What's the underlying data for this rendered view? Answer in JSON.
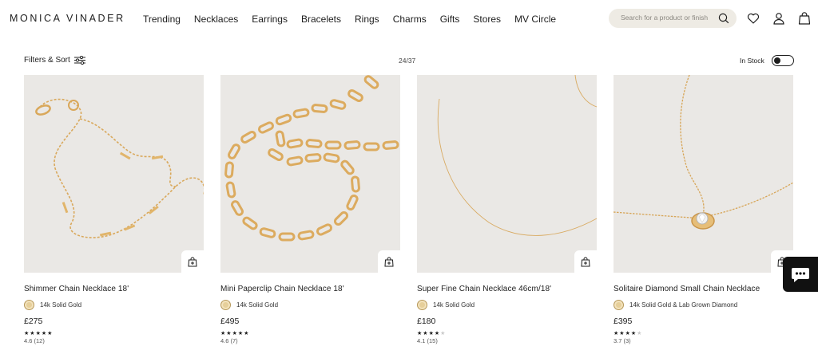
{
  "brand": "MONICA VINADER",
  "nav": [
    "Trending",
    "Necklaces",
    "Earrings",
    "Bracelets",
    "Rings",
    "Charms",
    "Gifts",
    "Stores",
    "MV Circle"
  ],
  "search": {
    "placeholder": "Search for a product or finish"
  },
  "icons": {
    "search": "search-icon",
    "wishlist": "heart-icon",
    "account": "user-icon",
    "bag": "shopping-bag-icon",
    "filters": "sliders-icon",
    "add_to_bag": "bag-plus-icon",
    "chat": "chat-icon"
  },
  "toolbar": {
    "filters_label": "Filters & Sort",
    "count": "24/37",
    "instock_label": "In Stock",
    "instock_on": false
  },
  "products": [
    {
      "name": "Shimmer Chain Necklace 18'",
      "metal": "14k Solid Gold",
      "price": "£275",
      "stars": 4.5,
      "rating": "4.6 (12)"
    },
    {
      "name": "Mini Paperclip Chain Necklace 18'",
      "metal": "14k Solid Gold",
      "price": "£495",
      "stars": 4.5,
      "rating": "4.6 (7)"
    },
    {
      "name": "Super Fine Chain Necklace 46cm/18'",
      "metal": "14k Solid Gold",
      "price": "£180",
      "stars": 4,
      "rating": "4.1 (15)"
    },
    {
      "name": "Solitaire Diamond Small Chain Necklace",
      "metal": "14k Solid Gold & Lab Grown Diamond",
      "price": "£395",
      "stars": 3.5,
      "rating": "3.7 (3)"
    }
  ],
  "colors": {
    "image_bg": "#eae8e5",
    "gold": "#d9a85b",
    "search_bg": "#eeebe4",
    "text": "#1d1d1d"
  }
}
